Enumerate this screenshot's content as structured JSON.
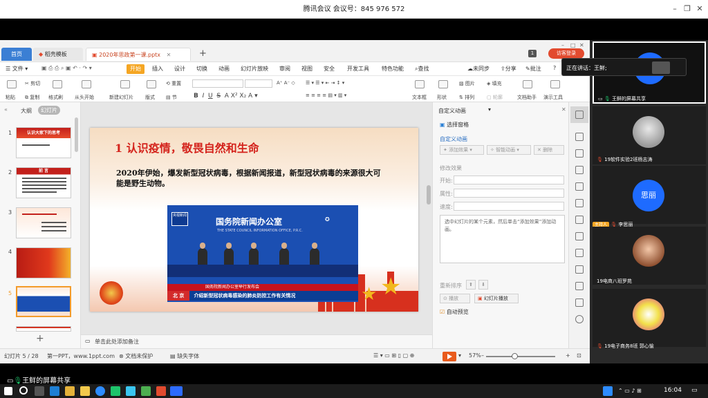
{
  "meeting": {
    "title": "腾讯会议 会议号：845 976 572"
  },
  "tabs": {
    "home": "首页",
    "template": "稻壳模板",
    "doc": "2020年思政第一课.pptx",
    "badge": "1",
    "visitor": "访客登录"
  },
  "menu": {
    "file": "文件",
    "start": "开始",
    "insert": "插入",
    "design": "设计",
    "transition": "切换",
    "animation": "动画",
    "slideshow": "幻灯片放映",
    "review": "审阅",
    "view": "视图",
    "security": "安全",
    "devtools": "开发工具",
    "special": "特色功能",
    "search": "查找",
    "sync": "未同步",
    "share": "分享",
    "comment": "批注"
  },
  "ribbon": {
    "cut": "剪切",
    "paste": "粘贴",
    "copy": "复制",
    "format_painter": "格式刷",
    "from_start": "从头开始",
    "new_slide": "新建幻灯片",
    "layout": "版式",
    "section": "节",
    "reset": "重置",
    "textbox": "文本框",
    "shape": "形状",
    "arrange": "排列",
    "outline": "轮廓",
    "image": "图片",
    "fill": "填充",
    "doc_assist": "文档助手",
    "presentation_tools": "演示工具"
  },
  "left_panel": {
    "outline": "大纲",
    "slides": "幻灯片",
    "thumbs": [
      {
        "num": "1",
        "title": "认识大家下的思考"
      },
      {
        "num": "2",
        "title": "前 言"
      },
      {
        "num": "3",
        "title": ""
      },
      {
        "num": "4",
        "title": ""
      },
      {
        "num": "5",
        "title": ""
      }
    ]
  },
  "slide": {
    "title": "1 认识疫情，敬畏自然和生命",
    "body": "2020年伊始，爆发新型冠状病毒，根据新闻报道，新型冠状病毒的来源很大可能是野生动物。",
    "photo": {
      "logo": "央视新闻",
      "org": "国务院新闻办公室",
      "org_en": "THE STATE COUNCIL INFORMATION OFFICE, P.R.C.",
      "caption1": "国务院新闻办公室举行发布会",
      "city": "北 京",
      "caption2": "介绍新型冠状病毒感染的肺炎防控工作有关情况"
    },
    "note": "单击此处添加备注"
  },
  "pane": {
    "title": "自定义动画",
    "select_pane": "选择窗格",
    "section": "自定义动画",
    "add_effect": "添加效果",
    "smart_anim": "智能动画",
    "delete": "删除",
    "modify": "修改效果",
    "start_label": "开始:",
    "prop_label": "属性:",
    "speed_label": "速度:",
    "hint": "选中幻灯片的某个元素，然后单击“添加效果”添加动画。",
    "reorder": "重新排序",
    "play": "播放",
    "slideshow": "幻灯片播放",
    "autopreview": "自动预览"
  },
  "status": {
    "slide_count": "幻灯片 5 / 28",
    "theme": "第一PPT，www.1ppt.com",
    "protect": "文档未保护",
    "font_missing": "缺失字体",
    "zoom": "57%"
  },
  "participants": {
    "speaking": "正在讲话：王鲜;",
    "host_tag": "主持人",
    "list": [
      {
        "name": "王鲜的屏幕共享",
        "avatar_text": "",
        "color": "#1e6bff"
      },
      {
        "name": "19软件实验2班杨志涛",
        "avatar_text": "",
        "color": "#c8c8c8"
      },
      {
        "name": "李思丽",
        "avatar_text": "思丽",
        "color": "#1e6bff"
      },
      {
        "name": "19电商八班罗苑",
        "avatar_text": "",
        "color": "#e5a88a"
      },
      {
        "name": "19电子商务8班 郭心愉",
        "avatar_text": "",
        "color": "#f2e04a"
      }
    ]
  },
  "share_strip": "王鲜的屏幕共享",
  "taskbar": {
    "time": "16:04"
  }
}
